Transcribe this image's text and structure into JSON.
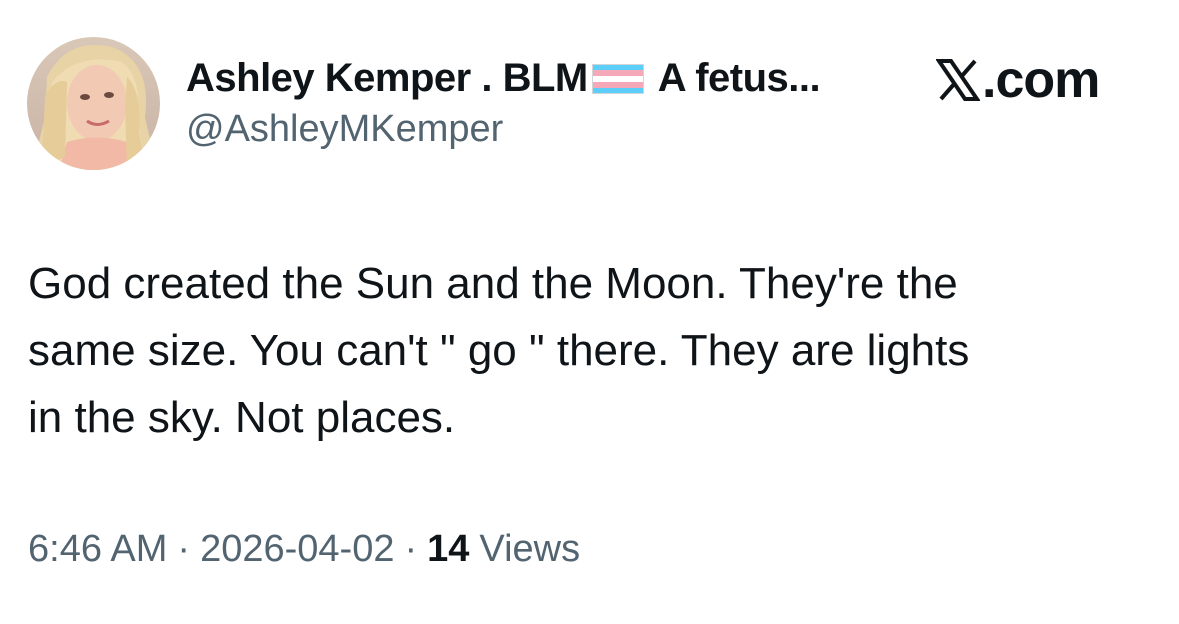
{
  "author": {
    "display_name": "Ashley Kemper . BLM",
    "name_suffix": "A fetus...",
    "flag_icon": "transgender-flag",
    "handle": "@AshleyMKemper"
  },
  "platform": {
    "icon": "x-logo-icon",
    "domain": ".com"
  },
  "tweet": {
    "lines": [
      "God created the Sun and the Moon. They're the",
      "same size. You can't \" go \" there. They are lights",
      "in the sky. Not places."
    ]
  },
  "meta": {
    "time": "6:46 AM",
    "separator": "·",
    "date": "2026-04-02",
    "views_count": "14",
    "views_label": "Views"
  },
  "colors": {
    "text": "#0f1419",
    "secondary": "#536471",
    "flag_blue": "#5bcefa",
    "flag_pink": "#f5a9b8",
    "flag_white": "#ffffff"
  }
}
